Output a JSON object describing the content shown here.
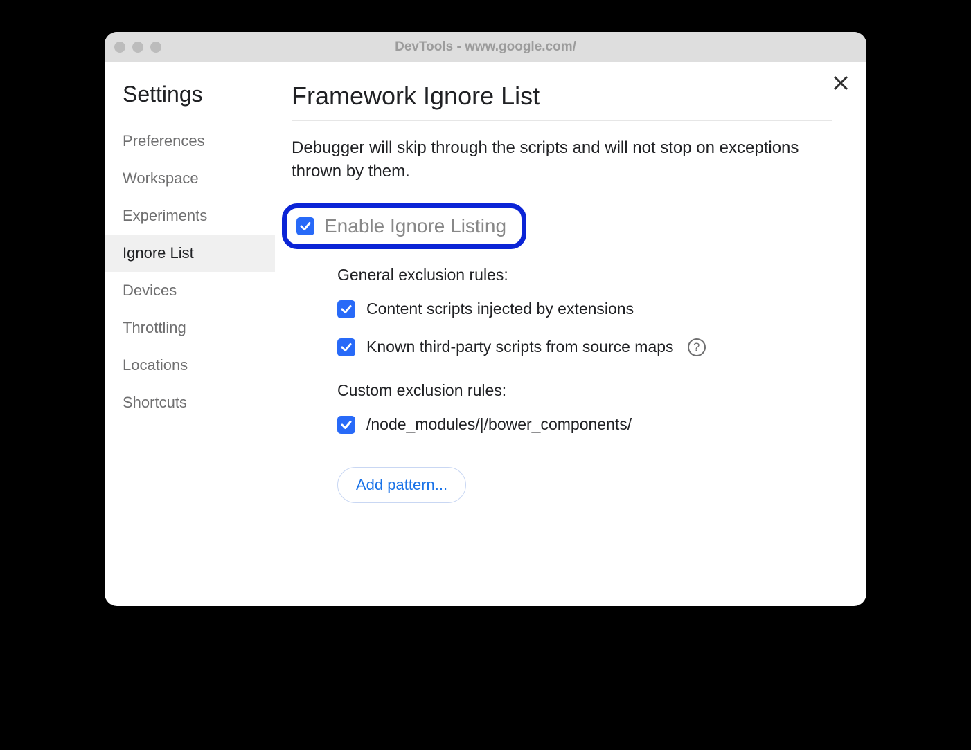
{
  "window": {
    "title": "DevTools - www.google.com/"
  },
  "sidebar": {
    "title": "Settings",
    "items": [
      {
        "label": "Preferences"
      },
      {
        "label": "Workspace"
      },
      {
        "label": "Experiments"
      },
      {
        "label": "Ignore List"
      },
      {
        "label": "Devices"
      },
      {
        "label": "Throttling"
      },
      {
        "label": "Locations"
      },
      {
        "label": "Shortcuts"
      }
    ],
    "selected_index": 3
  },
  "main": {
    "title": "Framework Ignore List",
    "description": "Debugger will skip through the scripts and will not stop on exceptions thrown by them.",
    "enable_label": "Enable Ignore Listing",
    "enable_checked": true,
    "general": {
      "title": "General exclusion rules:",
      "rules": [
        {
          "label": "Content scripts injected by extensions",
          "checked": true,
          "help": false
        },
        {
          "label": "Known third-party scripts from source maps",
          "checked": true,
          "help": true
        }
      ]
    },
    "custom": {
      "title": "Custom exclusion rules:",
      "rules": [
        {
          "label": "/node_modules/|/bower_components/",
          "checked": true
        }
      ]
    },
    "add_button": "Add pattern..."
  }
}
